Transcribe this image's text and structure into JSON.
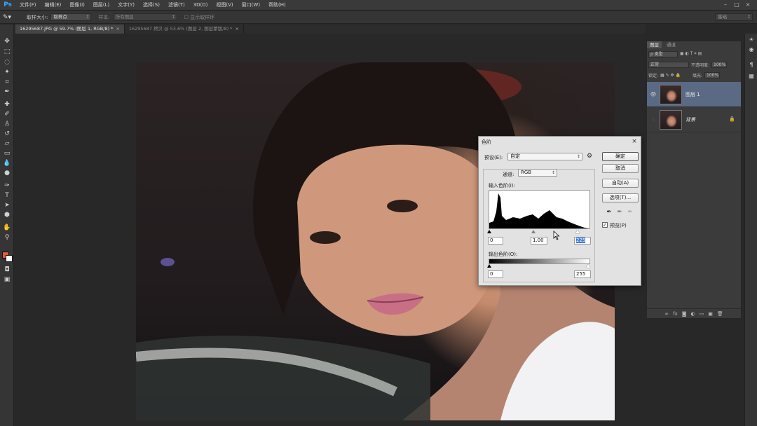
{
  "app": {
    "logo": "Ps",
    "menu": [
      "文件(F)",
      "编辑(E)",
      "图像(I)",
      "图层(L)",
      "文字(Y)",
      "选择(S)",
      "滤镜(T)",
      "3D(D)",
      "视图(V)",
      "窗口(W)",
      "帮助(H)"
    ],
    "workspace": "基础"
  },
  "options_bar": {
    "sample_size_label": "取样大小:",
    "sample_size_value": "取样点",
    "sample_label": "样本:",
    "sample_value": "所有图层",
    "show_ring_label": "显示取样环"
  },
  "tabs": [
    {
      "label": "16295687.JPG @ 59.7% (图层 1, RGB/8) *",
      "active": true
    },
    {
      "label": "16295687 拷贝 @ 53.6% (图层 2, 图层蒙版/8) *",
      "active": false
    }
  ],
  "layers_panel": {
    "tabs": [
      "图层",
      "通道"
    ],
    "filter_kind": "ρ 类型",
    "blend_mode": "正常",
    "opacity_label": "不透明度:",
    "opacity_value": "100%",
    "lock_label": "锁定:",
    "fill_label": "填充:",
    "fill_value": "100%",
    "layers": [
      {
        "name": "图层 1",
        "visible": true,
        "selected": true
      },
      {
        "name": "背景",
        "visible": false,
        "selected": false,
        "locked": true
      }
    ]
  },
  "levels_dialog": {
    "title": "色阶",
    "preset_label": "预设(E):",
    "preset_value": "自定",
    "channel_label": "通道:",
    "channel_value": "RGB",
    "input_levels_label": "输入色阶(I):",
    "input_black": "0",
    "input_gamma": "1.00",
    "input_white": "225",
    "output_levels_label": "输出色阶(O):",
    "output_black": "0",
    "output_white": "255",
    "buttons": {
      "ok": "确定",
      "cancel": "取消",
      "auto": "自动(A)",
      "options": "选项(T)..."
    },
    "preview_label": "预览(P)",
    "preview_checked": true
  },
  "colors": {
    "foreground": "#e8583a",
    "background": "#ffffff",
    "selection": "#5a6a84"
  }
}
